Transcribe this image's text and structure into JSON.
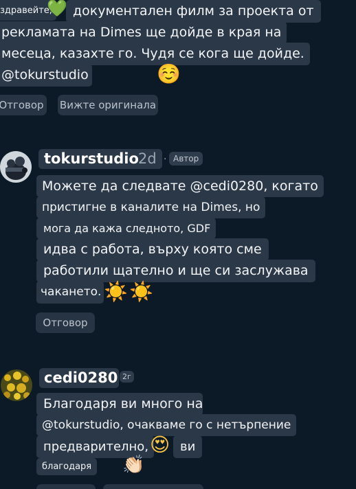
{
  "comment1": {
    "lines": [
      "здравейте,",
      "документален филм за проекта от",
      "рекламата на Dimes ще дойде в края на",
      "месеца, казахте го. Чудя се кога ще дойде.",
      "@tokurstudio"
    ],
    "emojis": {
      "heart": "💚",
      "smile": "☺️"
    },
    "reply_label": "Отговор",
    "view_original_label": "Вижте оригинала"
  },
  "comment2": {
    "username": "tokurstudio",
    "time": "2d",
    "separator": "·",
    "badge": "Автор",
    "lines": [
      "Можете да следвате @cedi0280, когато",
      "пристигне в каналите на Dimes, но",
      "мога да кажа следното, GDF",
      "идва с работа, върху която сме",
      "работили щателно и ще си заслужава",
      "чакането."
    ],
    "emojis": {
      "sun": "☀️"
    },
    "reply_label": "Отговор"
  },
  "comment3": {
    "username": "cedi0280",
    "time": "2г",
    "lines": [
      "Благодаря ви много на",
      "@tokurstudio, очакваме го с нетърпение",
      "предварително,",
      "ви",
      "благодаря"
    ],
    "emojis": {
      "heart_eyes": "😍",
      "clap": "👏🏻"
    }
  }
}
